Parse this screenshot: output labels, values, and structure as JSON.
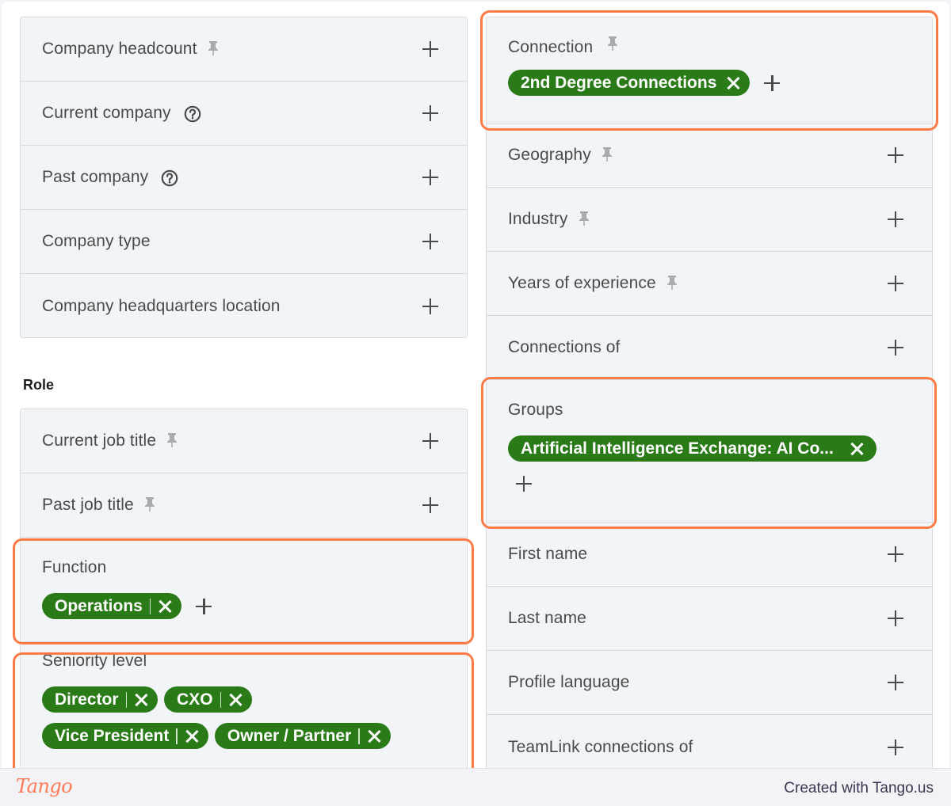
{
  "company_section": {
    "rows": [
      {
        "label": "Company headcount",
        "icon": "pin-icon"
      },
      {
        "label": "Current company",
        "icon": "help-icon"
      },
      {
        "label": "Past company",
        "icon": "help-icon"
      },
      {
        "label": "Company type",
        "icon": null
      },
      {
        "label": "Company headquarters location",
        "icon": null
      }
    ]
  },
  "role_section": {
    "heading": "Role",
    "rows": [
      {
        "label": "Current job title",
        "icon": "pin-icon"
      },
      {
        "label": "Past job title",
        "icon": "pin-icon"
      }
    ],
    "function": {
      "label": "Function",
      "pills": [
        {
          "text": "Operations"
        }
      ]
    },
    "seniority": {
      "label": "Seniority level",
      "pills": [
        {
          "text": "Director"
        },
        {
          "text": "CXO"
        },
        {
          "text": "Vice President"
        },
        {
          "text": "Owner / Partner"
        }
      ]
    }
  },
  "right_column": {
    "connection": {
      "label": "Connection",
      "icon": "pin-icon",
      "pills": [
        {
          "text": "2nd Degree Connections"
        }
      ]
    },
    "rows_top": [
      {
        "label": "Geography",
        "icon": "pin-icon"
      },
      {
        "label": "Industry",
        "icon": "pin-icon"
      },
      {
        "label": "Years of experience",
        "icon": "pin-icon"
      },
      {
        "label": "Connections of",
        "icon": null
      }
    ],
    "groups": {
      "label": "Groups",
      "pills": [
        {
          "text": "Artificial Intelligence Exchange: AI Co..."
        }
      ]
    },
    "rows_bottom": [
      {
        "label": "First name",
        "icon": null
      },
      {
        "label": "Last name",
        "icon": null
      },
      {
        "label": "Profile language",
        "icon": null
      },
      {
        "label": "TeamLink connections of",
        "icon": null
      }
    ]
  },
  "footer": {
    "logo": "Tango",
    "credit": "Created with Tango.us"
  },
  "colors": {
    "pill_green": "#2a7a17",
    "highlight_orange": "#ff7a45",
    "panel_bg": "#f2f5f8"
  }
}
